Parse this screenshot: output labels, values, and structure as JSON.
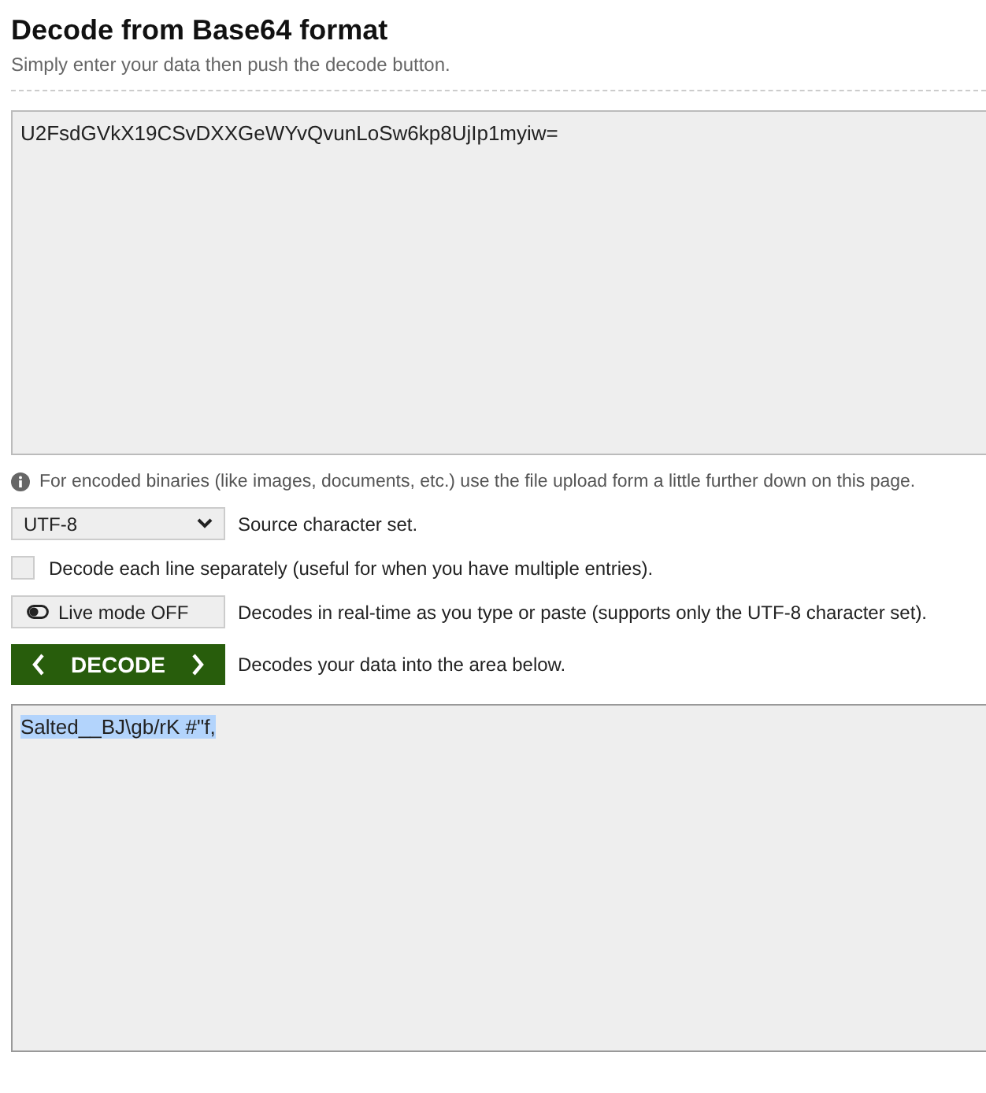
{
  "heading": "Decode from Base64 format",
  "subtitle": "Simply enter your data then push the decode button.",
  "input": {
    "value": "U2FsdGVkX19CSvDXXGeWYvQvunLoSw6kp8UjIp1myiw="
  },
  "info": "For encoded binaries (like images, documents, etc.) use the file upload form a little further down on this page.",
  "charset": {
    "value": "UTF-8",
    "hint": "Source character set."
  },
  "each_line": {
    "checked": false,
    "label": "Decode each line separately (useful for when you have multiple entries)."
  },
  "live_mode": {
    "label": "Live mode OFF",
    "on": false,
    "hint": "Decodes in real-time as you type or paste (supports only the UTF-8 character set)."
  },
  "decode": {
    "label": "DECODE",
    "hint": "Decodes your data into the area below."
  },
  "output": {
    "value": "Salted__BJ\\gb/rK #\"f,",
    "highlighted": true
  }
}
